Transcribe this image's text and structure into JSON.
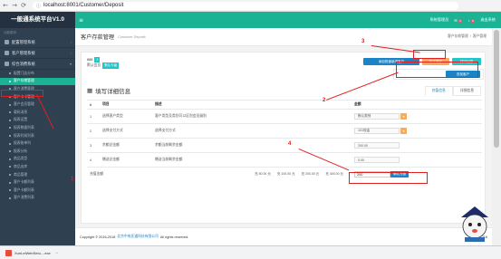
{
  "browser": {
    "url": "localhost:8001/Customer/Deposit",
    "back_glyph": "←",
    "forward_glyph": "→",
    "reload_glyph": "⟳",
    "lock_glyph": "ⓘ"
  },
  "sidebar": {
    "brand": "一般通系统平台V1.0",
    "nav_header": "功能模块",
    "groups": [
      {
        "label": "配置管理系统"
      },
      {
        "label": "客户管理系统"
      },
      {
        "label": "综合消费系统"
      }
    ],
    "items": [
      {
        "label": "配置门店分布"
      },
      {
        "label": "客户存储管理"
      },
      {
        "label": "客户消费管理"
      },
      {
        "label": "客户卡卡管理"
      },
      {
        "label": "客户会员管理"
      },
      {
        "label": "载码消息"
      },
      {
        "label": "报表设置"
      },
      {
        "label": "报表数据列表"
      },
      {
        "label": "报表利润列表"
      },
      {
        "label": "报表账单列"
      },
      {
        "label": "报表分析"
      },
      {
        "label": "商品类型"
      },
      {
        "label": "商品出库"
      },
      {
        "label": "商品管理"
      },
      {
        "label": "客户卡额列表"
      },
      {
        "label": "客户卡额列表"
      },
      {
        "label": "客户消费列表"
      }
    ],
    "arrow_glyph": "‹",
    "collapse_glyph": "▾"
  },
  "topbar": {
    "menu_glyph": "≡",
    "user": "系统管理员",
    "badge1": "0",
    "badge2": "8",
    "logout": "退出系统"
  },
  "page": {
    "title": "客户存款管理",
    "subtitle": "Customer Deposit",
    "breadcrumb": [
      "客户存款管理",
      "/",
      "客户管理"
    ]
  },
  "customer": {
    "id_label": "888",
    "id_badge": "2",
    "name_label": "默认会员",
    "name_badge": "默认卡级"
  },
  "buttons": {
    "new_customer": "添加快速新增客户",
    "deposit": "存卡操作",
    "print": "打印记录",
    "search": "查找客户"
  },
  "section": {
    "title": "填写详细信息",
    "tabs": [
      "充值信息",
      "详细信息"
    ]
  },
  "table": {
    "headers": [
      "#",
      "项目",
      "描述",
      "金额"
    ],
    "rows": [
      {
        "num": "1",
        "item": "选择客户类型",
        "desc": "客户类型及类别可以区别会员级别",
        "value": "默认类别"
      },
      {
        "num": "2",
        "item": "选择支付方式",
        "desc": "选择支付方式",
        "value": "101现金"
      },
      {
        "num": "3",
        "item": "余额总金额",
        "desc": "余额当前剩余金额",
        "value": "200.00"
      },
      {
        "num": "4",
        "item": "赠送总金额",
        "desc": "赠送当前剩余金额",
        "value": "0.00"
      }
    ],
    "total_label": "充值金额",
    "quick_amounts": [
      "充 50.00 元",
      "充 100.00 元",
      "充 200.00 元",
      "充 400.00 元"
    ],
    "amount_value": "200",
    "pay_button": "确认充值"
  },
  "footer": {
    "copyright": "Copyright © 2016-2018",
    "company": "北京中电亚通科技有限公司",
    "rights": "All rights reserved.",
    "version": "Ver 1.1.116"
  },
  "downloads": {
    "file": "XunLeiWebSetu....exe",
    "arrow": "^"
  },
  "annotations": [
    "1",
    "2",
    "3",
    "4"
  ],
  "colors": {
    "sidebar": "#2f4050",
    "accent": "#1ab394",
    "primary": "#1c84c6",
    "warning": "#f8ac59",
    "annotation": "#e02020"
  }
}
